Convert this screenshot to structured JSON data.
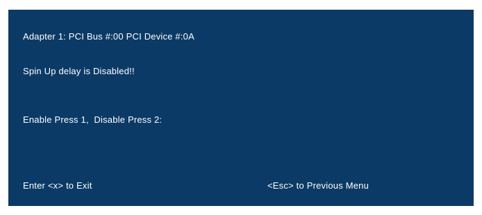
{
  "screen": {
    "background": "#0c3a66",
    "text_color": "#ffffff",
    "adapter_line": "Adapter 1: PCI Bus #:00 PCI Device #:0A",
    "status_line": "Spin Up delay is Disabled!!",
    "prompt_line": "Enable Press 1,  Disable Press 2:",
    "footer": {
      "exit_hint": "Enter <x> to Exit",
      "back_hint": "<Esc> to Previous Menu"
    }
  }
}
